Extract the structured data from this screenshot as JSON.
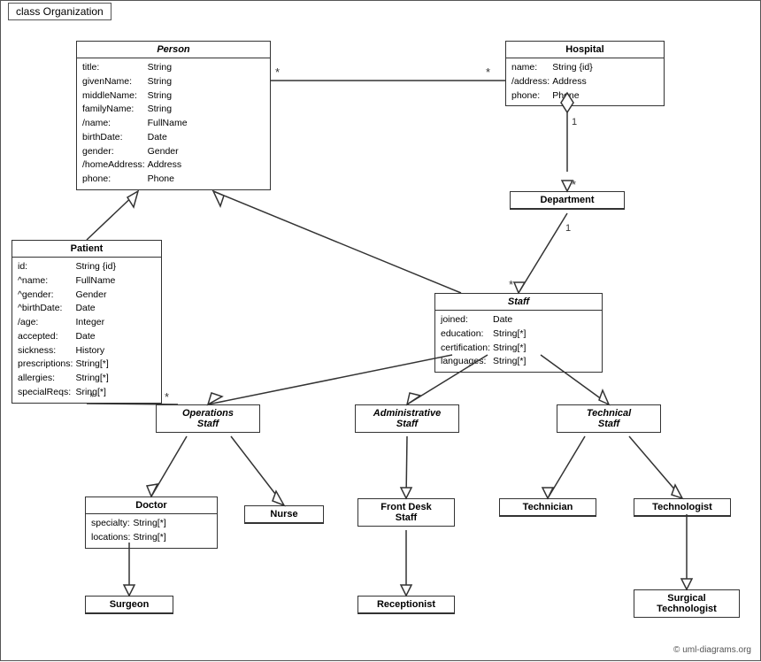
{
  "title": "class Organization",
  "classes": {
    "person": {
      "name": "Person",
      "italic": true,
      "attrs": [
        [
          "title:",
          "String"
        ],
        [
          "givenName:",
          "String"
        ],
        [
          "middleName:",
          "String"
        ],
        [
          "familyName:",
          "String"
        ],
        [
          "/name:",
          "FullName"
        ],
        [
          "birthDate:",
          "Date"
        ],
        [
          "gender:",
          "Gender"
        ],
        [
          "/homeAddress:",
          "Address"
        ],
        [
          "phone:",
          "Phone"
        ]
      ]
    },
    "hospital": {
      "name": "Hospital",
      "italic": false,
      "attrs": [
        [
          "name:",
          "String {id}"
        ],
        [
          "/address:",
          "Address"
        ],
        [
          "phone:",
          "Phone"
        ]
      ]
    },
    "department": {
      "name": "Department",
      "italic": false,
      "attrs": []
    },
    "staff": {
      "name": "Staff",
      "italic": true,
      "attrs": [
        [
          "joined:",
          "Date"
        ],
        [
          "education:",
          "String[*]"
        ],
        [
          "certification:",
          "String[*]"
        ],
        [
          "languages:",
          "String[*]"
        ]
      ]
    },
    "patient": {
      "name": "Patient",
      "italic": false,
      "attrs": [
        [
          "id:",
          "String {id}"
        ],
        [
          "^name:",
          "FullName"
        ],
        [
          "^gender:",
          "Gender"
        ],
        [
          "^birthDate:",
          "Date"
        ],
        [
          "/age:",
          "Integer"
        ],
        [
          "accepted:",
          "Date"
        ],
        [
          "sickness:",
          "History"
        ],
        [
          "prescriptions:",
          "String[*]"
        ],
        [
          "allergies:",
          "String[*]"
        ],
        [
          "specialReqs:",
          "Sring[*]"
        ]
      ]
    },
    "operations_staff": {
      "name": "Operations Staff",
      "italic": true
    },
    "administrative_staff": {
      "name": "Administrative Staff",
      "italic": true
    },
    "technical_staff": {
      "name": "Technical Staff",
      "italic": true
    },
    "doctor": {
      "name": "Doctor",
      "italic": false,
      "attrs": [
        [
          "specialty:",
          "String[*]"
        ],
        [
          "locations:",
          "String[*]"
        ]
      ]
    },
    "nurse": {
      "name": "Nurse",
      "italic": false
    },
    "front_desk_staff": {
      "name": "Front Desk Staff",
      "italic": false
    },
    "technician": {
      "name": "Technician",
      "italic": false
    },
    "technologist": {
      "name": "Technologist",
      "italic": false
    },
    "surgeon": {
      "name": "Surgeon",
      "italic": false
    },
    "receptionist": {
      "name": "Receptionist",
      "italic": false
    },
    "surgical_technologist": {
      "name": "Surgical Technologist",
      "italic": false
    }
  },
  "copyright": "© uml-diagrams.org"
}
